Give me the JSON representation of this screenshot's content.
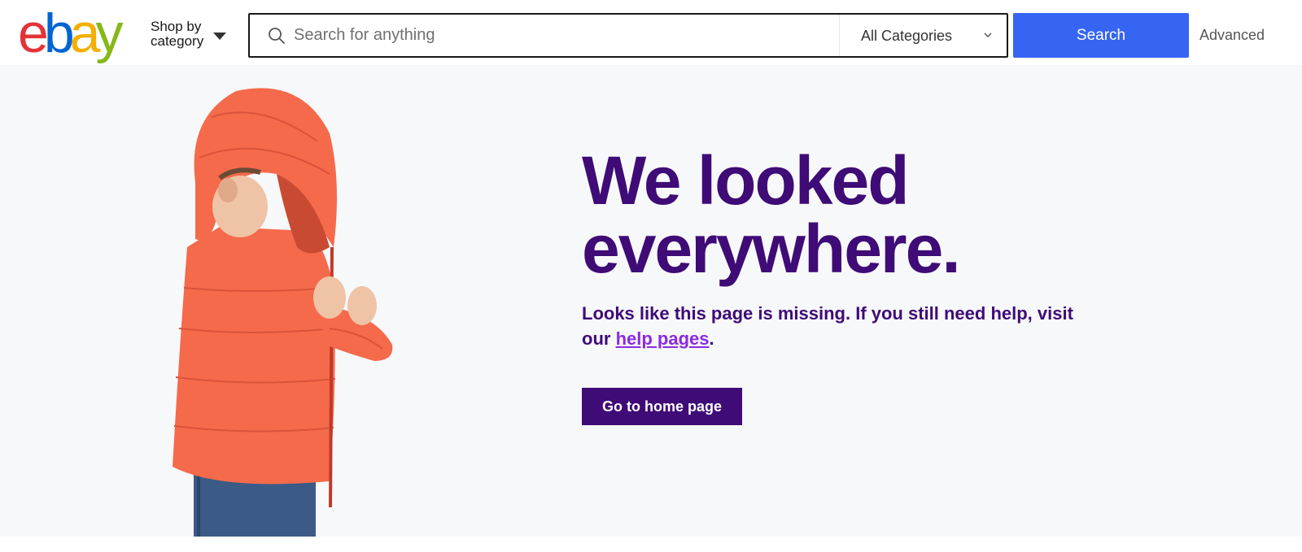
{
  "header": {
    "logo": {
      "letters": [
        "e",
        "b",
        "a",
        "y"
      ],
      "colors": [
        "#e53238",
        "#0064d2",
        "#f5af02",
        "#86b817"
      ]
    },
    "shop_by_category": {
      "line1": "Shop by",
      "line2": "category"
    },
    "search": {
      "placeholder": "Search for anything",
      "value": "",
      "category": "All Categories",
      "button_label": "Search"
    },
    "advanced_label": "Advanced"
  },
  "main": {
    "headline_line1": "We looked",
    "headline_line2": "everywhere.",
    "message_before_link": "Looks like this page is missing. If you still need help, visit our ",
    "help_link_label": "help pages",
    "message_after_link": ".",
    "home_button_label": "Go to home page"
  },
  "colors": {
    "brand_purple": "#3f0b76",
    "link_purple": "#8a2be2",
    "search_blue": "#3665f3",
    "page_bg": "#f7f8fa",
    "jacket": "#f56a4b"
  }
}
